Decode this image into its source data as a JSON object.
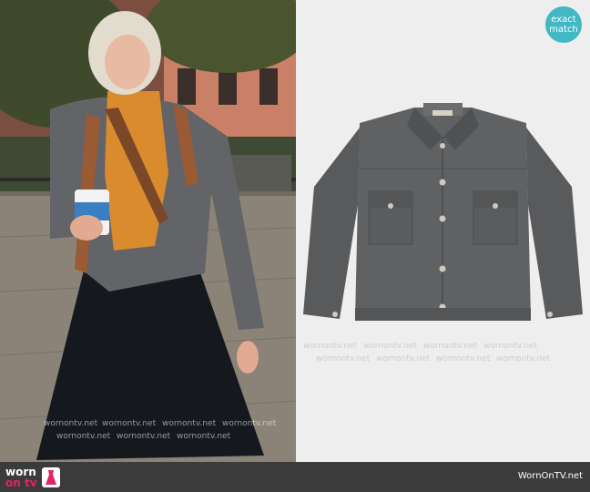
{
  "badge": {
    "line1": "exact",
    "line2": "match"
  },
  "brand": {
    "top": "worn",
    "bottom": "on tv"
  },
  "footer": {
    "site": "WornOnTV.net"
  },
  "watermark": {
    "text": "wornontv.net"
  },
  "colors": {
    "badge": "#41b8c4",
    "bar": "#3b3b3b",
    "accent": "#e0246b",
    "jacket": "#5e5f61"
  }
}
